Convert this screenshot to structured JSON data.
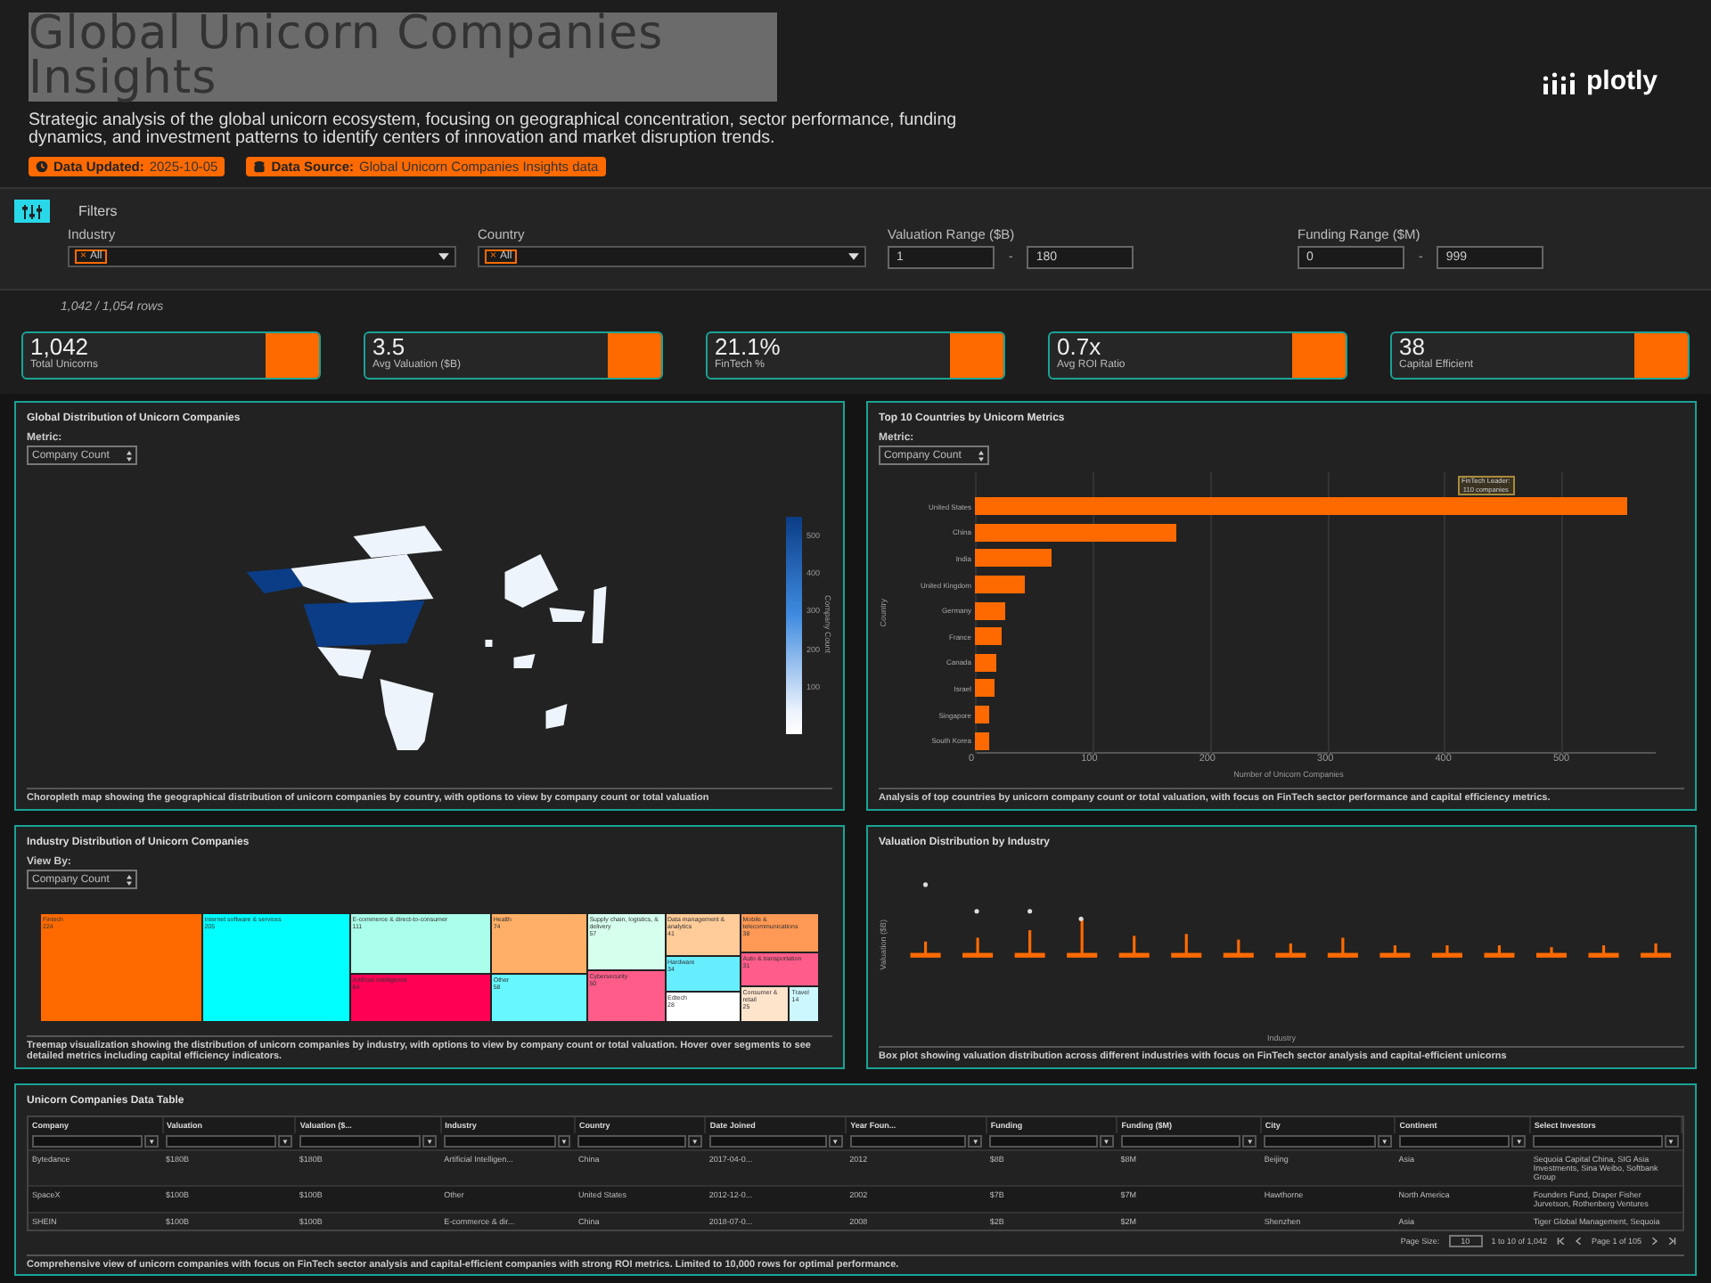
{
  "header": {
    "title": "Global Unicorn Companies Insights",
    "description": "Strategic analysis of the global unicorn ecosystem, focusing on geographical concentration, sector performance, funding dynamics, and investment patterns to identify centers of innovation and market disruption trends.",
    "badges": [
      {
        "kind": "clock",
        "label": "Data Updated:",
        "value": "2025-10-05"
      },
      {
        "kind": "database",
        "label": "Data Source:",
        "value": "Global Unicorn Companies Insights data"
      }
    ],
    "logo": "plotly"
  },
  "filters": {
    "title": "Filters",
    "fields": [
      {
        "kind": "multiselect",
        "label": "Industry",
        "chip_remove": "×",
        "chip": "All"
      },
      {
        "kind": "multiselect",
        "label": "Country",
        "chip_remove": "×",
        "chip": "All"
      },
      {
        "kind": "range",
        "label": "Valuation Range ($B)",
        "min": "1",
        "separator": "-",
        "max": "180"
      },
      {
        "kind": "range",
        "label": "Funding Range ($M)",
        "min": "0",
        "separator": "-",
        "max": "999"
      }
    ]
  },
  "row_count": "1,042 / 1,054 rows",
  "kpis": [
    {
      "value": "1,042",
      "label": "Total Unicorns"
    },
    {
      "value": "3.5",
      "label": "Avg Valuation ($B)"
    },
    {
      "value": "21.1%",
      "label": "FinTech %"
    },
    {
      "value": "0.7x",
      "label": "Avg ROI Ratio"
    },
    {
      "value": "38",
      "label": "Capital Efficient"
    }
  ],
  "map_panel": {
    "title": "Global Distribution of Unicorn Companies",
    "metric_label": "Metric:",
    "metric": "Company Count",
    "colorbar_title": "Company Count",
    "colorbar_ticks": [
      "500",
      "400",
      "300",
      "200",
      "100"
    ],
    "caption": "Choropleth map showing the geographical distribution of unicorn companies by country, with options to view by company count or total valuation"
  },
  "bar_panel": {
    "title": "Top 10 Countries by Unicorn Metrics",
    "metric_label": "Metric:",
    "metric": "Company Count",
    "chart_data": {
      "type": "bar",
      "orientation": "horizontal",
      "categories": [
        "United States",
        "China",
        "India",
        "United Kingdom",
        "Germany",
        "France",
        "Canada",
        "Israel",
        "Singapore",
        "South Korea"
      ],
      "values": [
        555,
        171,
        65,
        43,
        26,
        23,
        18,
        16,
        12,
        12
      ],
      "xlabel": "Number of Unicorn Companies",
      "ylabel": "Country",
      "xlim": [
        0,
        580
      ],
      "xticks": [
        0,
        100,
        200,
        300,
        400,
        500
      ],
      "annotations": [
        "FinTech Leader: 110 companies"
      ]
    },
    "caption": "Analysis of top countries by unicorn company count or total valuation, with focus on FinTech sector performance and capital efficiency metrics."
  },
  "treemap_panel": {
    "title": "Industry Distribution of Unicorn Companies",
    "view_label": "View By:",
    "view": "Company Count",
    "tiles": [
      {
        "label": "Fintech",
        "value": "224",
        "color": "#ff6a00"
      },
      {
        "label": "Internet software & services",
        "value": "205",
        "color": "#00ffff"
      },
      {
        "label": "E-commerce & direct-to-consumer",
        "value": "111",
        "color": "#aaffea"
      },
      {
        "label": "Artificial intelligence",
        "value": "84",
        "color": "#ff0055"
      },
      {
        "label": "Health",
        "value": "74",
        "color": "#ffb066"
      },
      {
        "label": "Other",
        "value": "58",
        "color": "#66f7ff"
      },
      {
        "label": "Supply chain, logistics, & delivery",
        "value": "57",
        "color": "#d6ffee"
      },
      {
        "label": "Cybersecurity",
        "value": "50",
        "color": "#ff5c8a"
      },
      {
        "label": "Data management & analytics",
        "value": "41",
        "color": "#ffcc99"
      },
      {
        "label": "Mobile & telecommunications",
        "value": "38",
        "color": "#ff9955"
      },
      {
        "label": "Hardware",
        "value": "34",
        "color": "#66eeff"
      },
      {
        "label": "Auto & transportation",
        "value": "31",
        "color": "#ff5c8a"
      },
      {
        "label": "Edtech",
        "value": "28",
        "color": "#ffffff"
      },
      {
        "label": "Consumer & retail",
        "value": "25",
        "color": "#ffe4cc"
      },
      {
        "label": "Travel",
        "value": "14",
        "color": "#ccf7ff"
      }
    ],
    "caption": "Treemap visualization showing the distribution of unicorn companies by industry, with options to view by company count or total valuation. Hover over segments to see detailed metrics including capital efficiency indicators."
  },
  "boxplot_panel": {
    "title": "Valuation Distribution by Industry",
    "xlabel": "Industry",
    "ylabel": "Valuation ($B)",
    "caption": "Box plot showing valuation distribution across different industries with focus on FinTech sector analysis and capital-efficient unicorns"
  },
  "table": {
    "title": "Unicorn Companies Data Table",
    "filter_icon": "▼",
    "columns": [
      "Company",
      "Valuation",
      "Valuation ($...",
      "Industry",
      "Country",
      "Date Joined",
      "Year Foun...",
      "Funding",
      "Funding ($M)",
      "City",
      "Continent",
      "Select Investors"
    ],
    "rows": [
      [
        "Bytedance",
        "$180B",
        "$180B",
        "Artificial Intelligen...",
        "China",
        "2017-04-0...",
        "2012",
        "$8B",
        "$8M",
        "Beijing",
        "Asia",
        "Sequoia Capital China, SIG Asia Investments, Sina Weibo, Softbank Group"
      ],
      [
        "SpaceX",
        "$100B",
        "$100B",
        "Other",
        "United States",
        "2012-12-0...",
        "2002",
        "$7B",
        "$7M",
        "Hawthorne",
        "North America",
        "Founders Fund, Draper Fisher Jurvetson, Rothenberg Ventures"
      ],
      [
        "SHEIN",
        "$100B",
        "$100B",
        "E-commerce & dir...",
        "China",
        "2018-07-0...",
        "2008",
        "$2B",
        "$2M",
        "Shenzhen",
        "Asia",
        "Tiger Global Management, Sequoia"
      ]
    ],
    "page_size_label": "Page Size:",
    "page_size": "10",
    "range": "1 to 10 of 1,042",
    "page": "Page 1 of 105",
    "caption": "Comprehensive view of unicorn companies with focus on FinTech sector analysis and capital-efficient companies with strong ROI metrics. Limited to 10,000 rows for optimal performance."
  }
}
